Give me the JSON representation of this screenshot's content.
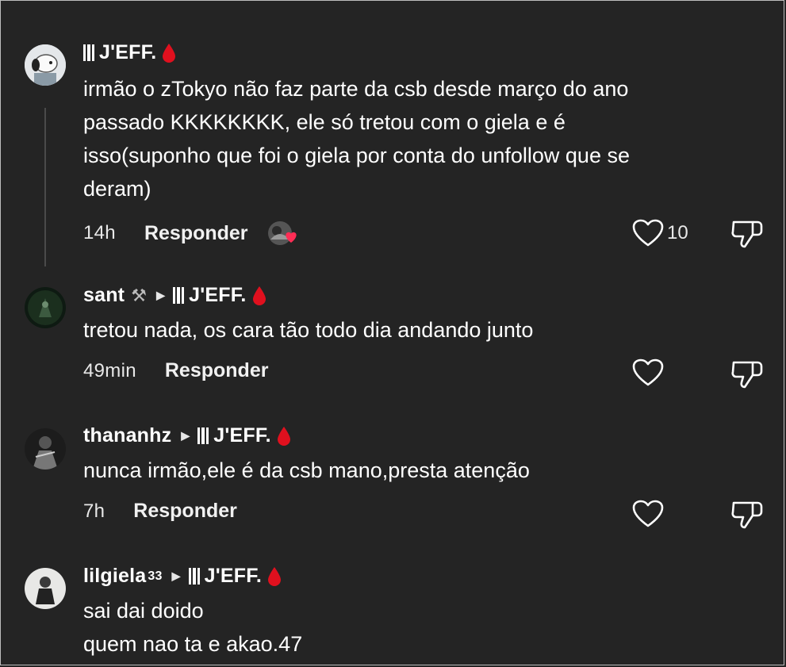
{
  "comments": [
    {
      "author": "J'EFF.",
      "text": "irmão o zTokyo não faz parte da csb desde março do ano\npassado KKKKKKKK, ele só tretou com o giela e é\nisso(suponho que foi o giela por conta do unfollow que se\nderam)",
      "time": "14h",
      "reply": "Responder",
      "likes": "10"
    },
    {
      "author": "sant",
      "reply_to": "J'EFF.",
      "text": "tretou nada, os cara tão todo dia andando junto",
      "time": "49min",
      "reply": "Responder"
    },
    {
      "author": "thananhz",
      "reply_to": "J'EFF.",
      "text": "nunca irmão,ele é da csb mano,presta atenção",
      "time": "7h",
      "reply": "Responder"
    },
    {
      "author": "lilgiela",
      "author_sup": "33",
      "reply_to": "J'EFF.",
      "text": "sai dai doido\nquem nao ta e akao.47"
    }
  ],
  "colors": {
    "background": "#242424",
    "text": "#ffffff",
    "drop": "#e0101e",
    "heart_badge": "#ff2d55"
  },
  "icons": {
    "like": "heart-outline-icon",
    "dislike": "thumbs-down-icon",
    "badge": "blood-drop-icon",
    "hammer": "hammer-icon"
  }
}
